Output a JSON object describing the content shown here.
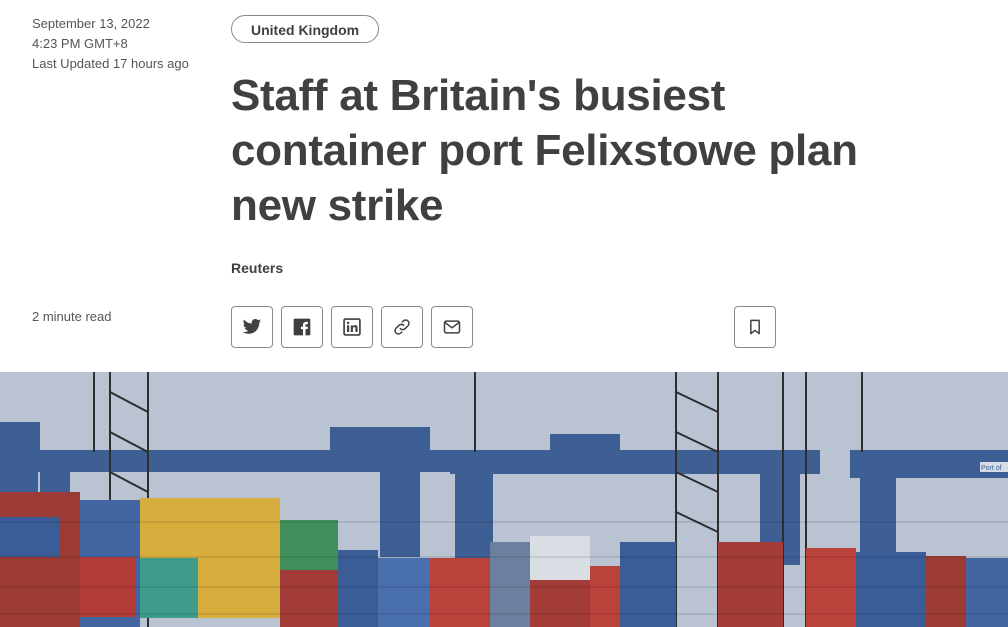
{
  "meta": {
    "date": "September 13, 2022",
    "time": "4:23 PM GMT+8",
    "updated": "Last Updated 17 hours ago",
    "read_time": "2 minute read"
  },
  "article": {
    "tag": "United Kingdom",
    "headline": "Staff at Britain's busiest container port Felixstowe plan new strike",
    "byline": "Reuters"
  },
  "share_icons": [
    "twitter-icon",
    "facebook-icon",
    "linkedin-icon",
    "link-icon",
    "email-icon"
  ],
  "bookmark_icon": "bookmark-icon",
  "hero_image": {
    "sign_text": "Port of"
  },
  "colors": {
    "text": "#404040",
    "border": "#8a8a8a",
    "sky": "#b9c3d2",
    "crane_blue": "#3d5f93"
  }
}
